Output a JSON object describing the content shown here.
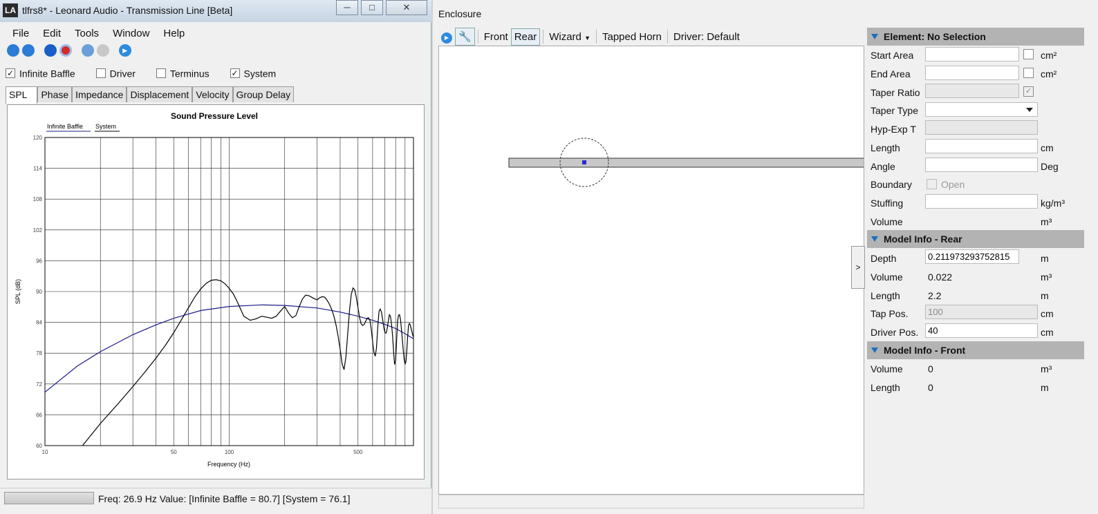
{
  "window_left": {
    "title": "tlfrs8* - Leonard Audio - Transmission Line [Beta]",
    "logo_text": "LA",
    "menu": [
      "File",
      "Edit",
      "Tools",
      "Window",
      "Help"
    ],
    "checks": [
      {
        "label": "Infinite Baffle",
        "checked": true
      },
      {
        "label": "Driver",
        "checked": false
      },
      {
        "label": "Terminus",
        "checked": false
      },
      {
        "label": "System",
        "checked": true
      }
    ],
    "tabs": [
      "SPL",
      "Phase",
      "Impedance",
      "Displacement",
      "Velocity",
      "Group Delay"
    ],
    "status": {
      "text": "Freq: 26.9 Hz   Value: [Infinite Baffle = 80.7]  [System = 76.1]"
    }
  },
  "chart_data": {
    "type": "line",
    "title": "Sound Pressure Level",
    "xlabel": "Frequency (Hz)",
    "ylabel": "SPL (dB)",
    "xscale": "log",
    "xlim": [
      10,
      1000
    ],
    "ylim": [
      60,
      120
    ],
    "x_tick_labels": [
      "10",
      "50",
      "100",
      "500"
    ],
    "y_tick_labels": [
      "60",
      "66",
      "72",
      "78",
      "84",
      "90",
      "96",
      "102",
      "108",
      "114",
      "120"
    ],
    "legend": [
      "Infinite Baffle",
      "System"
    ],
    "legend_position": "top-left",
    "grid": true,
    "series": [
      {
        "name": "Infinite Baffle",
        "color": "#1a1a8c",
        "x": [
          10,
          15,
          20,
          30,
          40,
          50,
          70,
          100,
          150,
          200,
          300,
          400,
          500,
          600,
          700,
          800,
          900,
          1000
        ],
        "y": [
          70.4,
          75.5,
          78.3,
          81.6,
          83.5,
          84.8,
          86.3,
          87.1,
          87.4,
          87.3,
          86.8,
          86.0,
          85.2,
          84.4,
          83.6,
          82.8,
          81.8,
          80.8
        ]
      },
      {
        "name": "System",
        "color": "#000000",
        "x": [
          16,
          20,
          25,
          30,
          35,
          40,
          45,
          50,
          55,
          60,
          65,
          70,
          75,
          80,
          85,
          90,
          95,
          100,
          105,
          110,
          120,
          130,
          140,
          150,
          160,
          170,
          180,
          190,
          200,
          210,
          220,
          230,
          240,
          250,
          260,
          270,
          280,
          290,
          300,
          310,
          320,
          330,
          340,
          350,
          360,
          370,
          380,
          390,
          400,
          410,
          420,
          430,
          440,
          450,
          460,
          470,
          480,
          490,
          500,
          510,
          520,
          530,
          540,
          550,
          560,
          570,
          580,
          590,
          600,
          610,
          620,
          630,
          640,
          650,
          660,
          670,
          680,
          690,
          700,
          710,
          720,
          730,
          740,
          750,
          760,
          770,
          780,
          790,
          800,
          810,
          820,
          830,
          840,
          850,
          860,
          870,
          880,
          890,
          900,
          910,
          920,
          930,
          940,
          950,
          960,
          970,
          980,
          990,
          1000
        ],
        "y": [
          60.0,
          64.3,
          68.2,
          71.5,
          74.4,
          77.0,
          79.5,
          82.0,
          84.5,
          86.8,
          88.9,
          90.5,
          91.6,
          92.2,
          92.3,
          92.1,
          91.5,
          90.6,
          89.6,
          88.2,
          85.2,
          84.4,
          84.7,
          85.2,
          85.0,
          84.8,
          85.2,
          86.2,
          87.1,
          85.8,
          84.9,
          85.3,
          87.1,
          88.6,
          89.3,
          89.2,
          88.9,
          88.6,
          88.4,
          88.8,
          89.0,
          88.9,
          88.3,
          87.5,
          86.5,
          85.2,
          83.5,
          81.3,
          78.8,
          75.9,
          74.8,
          77.3,
          82.0,
          86.5,
          89.5,
          90.7,
          90.3,
          88.8,
          86.8,
          84.9,
          83.7,
          83.4,
          83.6,
          84.2,
          84.8,
          84.9,
          84.4,
          82.7,
          80.2,
          78.2,
          77.4,
          79.0,
          83.0,
          86.1,
          86.6,
          86.0,
          84.6,
          83.0,
          82.0,
          81.9,
          82.8,
          84.3,
          85.5,
          85.2,
          83.7,
          81.5,
          78.4,
          75.8,
          76.6,
          80.5,
          84.2,
          85.4,
          85.5,
          84.6,
          82.8,
          80.6,
          78.6,
          76.8,
          75.9,
          76.3,
          78.4,
          81.2,
          83.4,
          83.8,
          83.5,
          82.9,
          82.2,
          81.6,
          81.1
        ]
      }
    ]
  },
  "window_right": {
    "title": "Enclosure",
    "toolbar": {
      "front": "Front",
      "rear": "Rear",
      "wizard": "Wizard",
      "tapped_horn": "Tapped Horn",
      "driver": "Driver: Default"
    },
    "toggle_label": ">",
    "element_header": "Element: No Selection",
    "element_props": [
      {
        "label": "Start Area",
        "unit": "cm²"
      },
      {
        "label": "End Area",
        "unit": "cm²"
      },
      {
        "label": "Taper Ratio",
        "unit": ""
      },
      {
        "label": "Taper Type",
        "unit": ""
      },
      {
        "label": "Hyp-Exp T",
        "unit": ""
      },
      {
        "label": "Length",
        "unit": "cm"
      },
      {
        "label": "Angle",
        "unit": "Deg"
      },
      {
        "label": "Boundary",
        "unit": "",
        "check_label": "Open"
      },
      {
        "label": "Stuffing",
        "unit": "kg/m³"
      },
      {
        "label": "Volume",
        "unit": "m³"
      }
    ],
    "rear_header": "Model Info - Rear",
    "rear_props": [
      {
        "label": "Depth",
        "value": "0.211973293752815",
        "unit": "m"
      },
      {
        "label": "Volume",
        "value": "0.022",
        "unit": "m³"
      },
      {
        "label": "Length",
        "value": "2.2",
        "unit": "m"
      },
      {
        "label": "Tap Pos.",
        "value": "100",
        "unit": "cm"
      },
      {
        "label": "Driver Pos.",
        "value": "40",
        "unit": "cm"
      }
    ],
    "front_header": "Model Info - Front",
    "front_props": [
      {
        "label": "Volume",
        "value": "0",
        "unit": "m³"
      },
      {
        "label": "Length",
        "value": "0",
        "unit": "m"
      }
    ]
  }
}
